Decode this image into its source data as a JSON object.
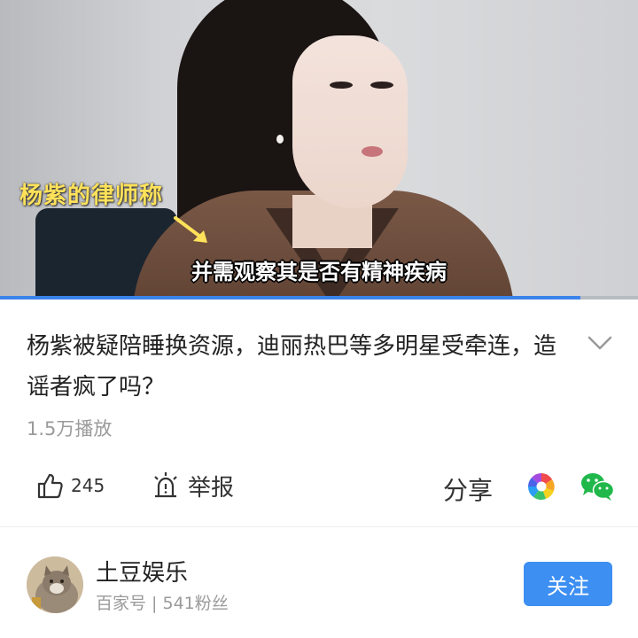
{
  "video": {
    "overlay_label": "杨紫的律师称",
    "subtitle": "并需观察其是否有精神疾病",
    "progress": 0.91
  },
  "post": {
    "title": "杨紫被疑陪睡换资源，迪丽热巴等多明星受牵连，造谣者疯了吗？",
    "views": "1.5万播放"
  },
  "actions": {
    "like_count": "245",
    "report_label": "举报",
    "share_label": "分享"
  },
  "author": {
    "name": "土豆娱乐",
    "meta": "百家号 | 541粉丝",
    "follow_label": "关注"
  },
  "colors": {
    "accent": "#3d8ff2",
    "overlay_text": "#ffe25a"
  },
  "icons": [
    "arrow-icon",
    "chevron-down-icon",
    "thumbs-up-icon",
    "report-icon",
    "pinwheel-share-icon",
    "wechat-icon"
  ]
}
